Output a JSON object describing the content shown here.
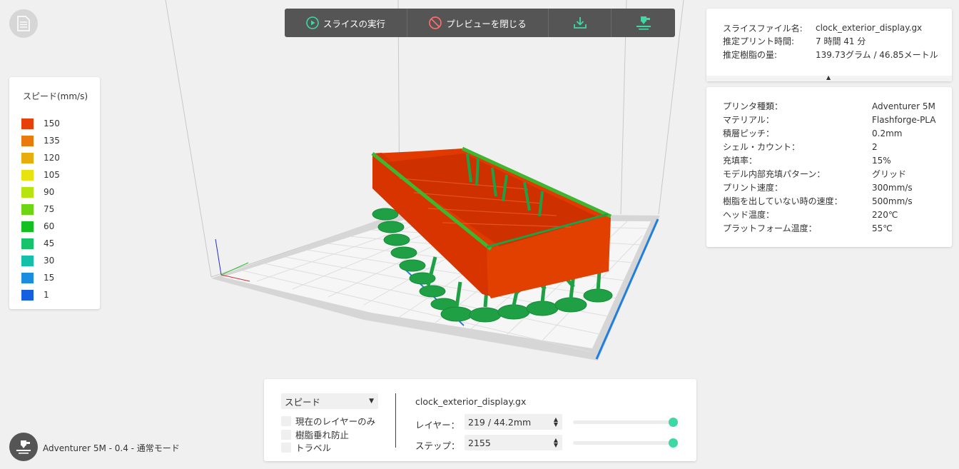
{
  "toolbar": {
    "slice_label": "スライスの実行",
    "close_preview_label": "プレビューを閉じる"
  },
  "legend": {
    "title": "スピード(mm/s)",
    "items": [
      {
        "value": "150",
        "color": "#e8400a"
      },
      {
        "value": "135",
        "color": "#eb7a0c"
      },
      {
        "value": "120",
        "color": "#e9ac0d"
      },
      {
        "value": "105",
        "color": "#e8e30e"
      },
      {
        "value": "90",
        "color": "#b6e40f"
      },
      {
        "value": "75",
        "color": "#6dd612"
      },
      {
        "value": "60",
        "color": "#12c020"
      },
      {
        "value": "45",
        "color": "#14c36a"
      },
      {
        "value": "30",
        "color": "#14c0aa"
      },
      {
        "value": "15",
        "color": "#1a8de0"
      },
      {
        "value": "1",
        "color": "#1560e0"
      }
    ]
  },
  "slice_info": {
    "file_name_label": "スライスファイル名:",
    "file_name": "clock_exterior_display.gx",
    "print_time_label": "推定プリント時間:",
    "print_time": "7 時間 41 分",
    "resin_label": "推定樹脂の量:",
    "resin": "139.73グラム / 46.85メートル"
  },
  "print_settings": [
    {
      "label": "プリンタ種類：",
      "value": "Adventurer 5M"
    },
    {
      "label": "マテリアル：",
      "value": "Flashforge-PLA"
    },
    {
      "label": "積層ピッチ：",
      "value": "0.2mm"
    },
    {
      "label": "シェル・カウント：",
      "value": "2"
    },
    {
      "label": "充填率：",
      "value": "15%"
    },
    {
      "label": "モデル内部充填パターン：",
      "value": "グリッド"
    },
    {
      "label": "プリント速度：",
      "value": "300mm/s"
    },
    {
      "label": "樹脂を出していない時の速度：",
      "value": "500mm/s"
    },
    {
      "label": "ヘッド温度：",
      "value": "220℃"
    },
    {
      "label": "プラットフォーム温度：",
      "value": "55℃"
    }
  ],
  "preview_panel": {
    "mode": "スピード",
    "current_layer_only": "現在のレイヤーのみ",
    "prevent_ooze": "樹脂垂れ防止",
    "travel": "トラベル",
    "file_name": "clock_exterior_display.gx",
    "layer_label": "レイヤー：",
    "layer_value": "219 / 44.2mm",
    "step_label": "ステップ：",
    "step_value": "2155",
    "layer_slider_fraction": 1.0,
    "step_slider_fraction": 1.0
  },
  "printer_status": "Adventurer 5M - 0.4 - 通常モード",
  "colors": {
    "accent": "#3ed7a6",
    "model_red": "#e03a00",
    "support_green": "#1fa045"
  }
}
